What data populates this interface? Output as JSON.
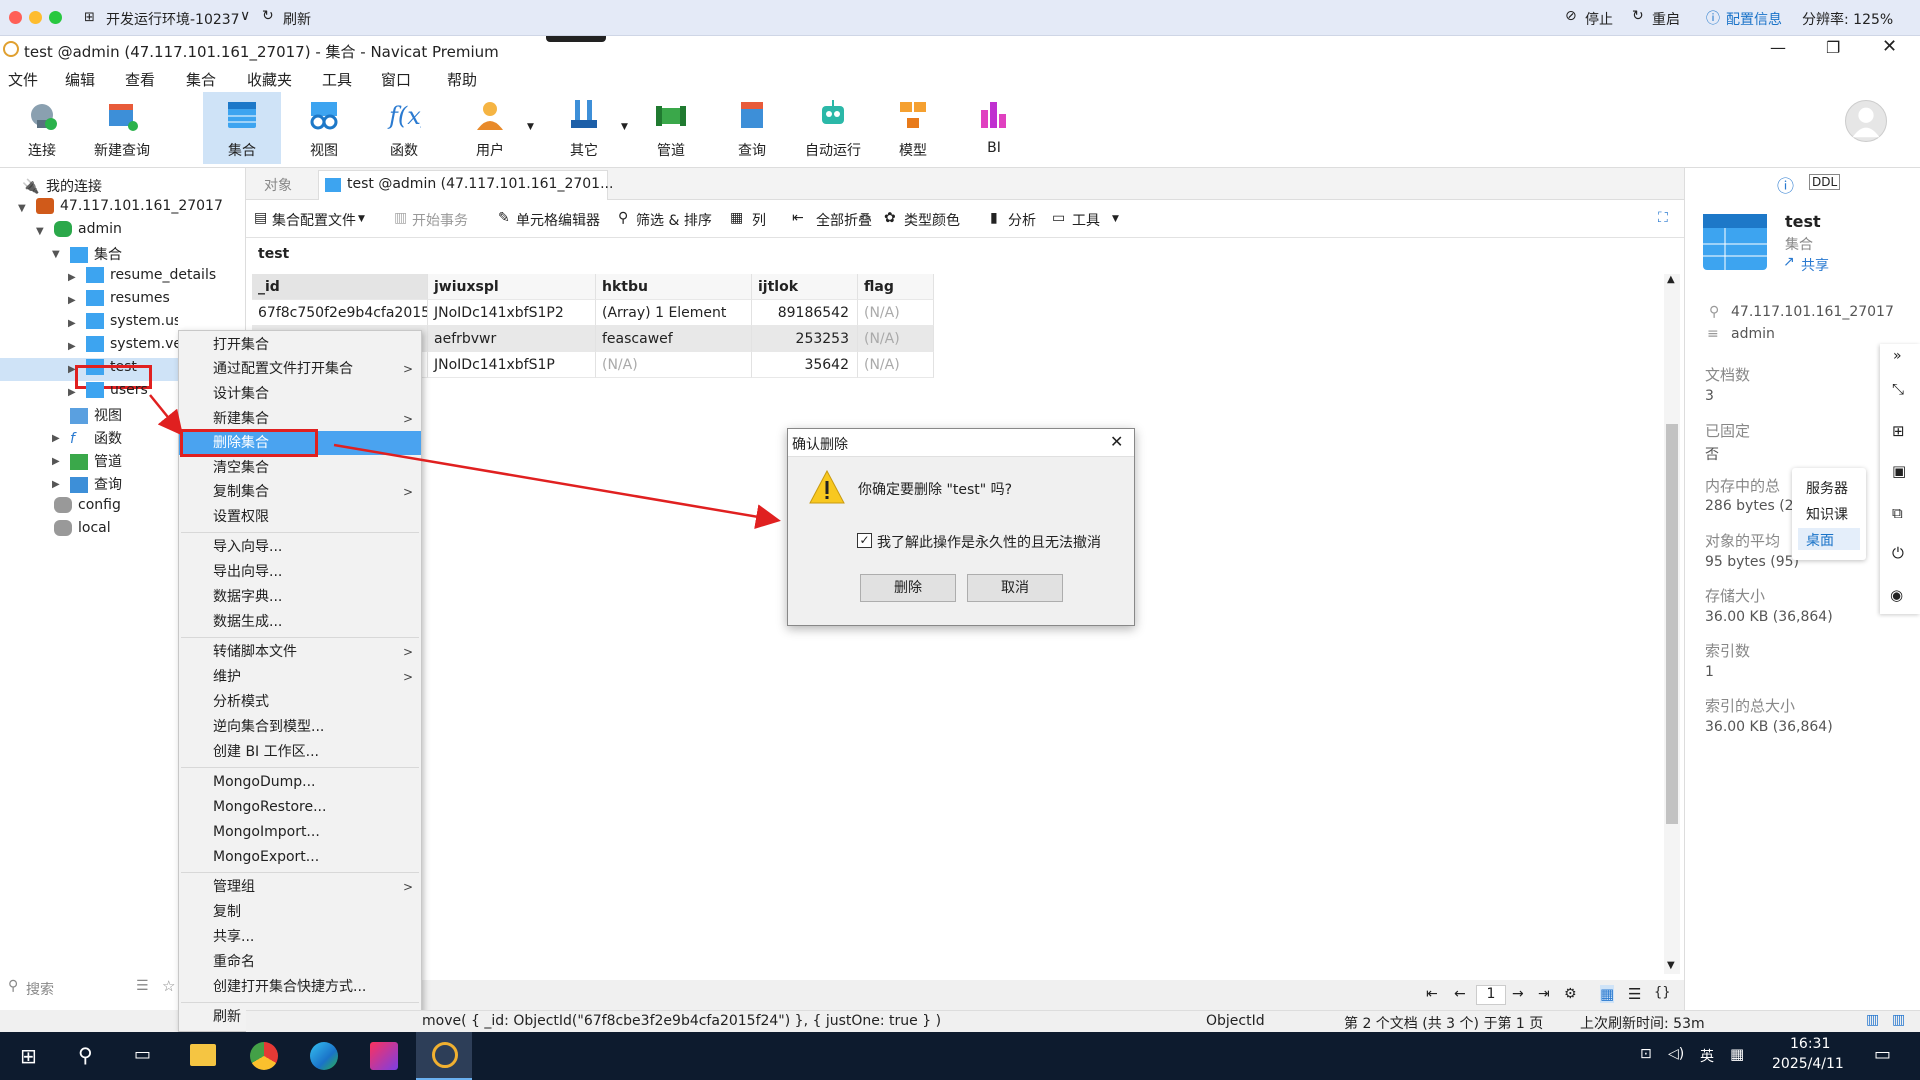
{
  "remote": {
    "env_label": "开发运行环境-10237",
    "refresh": "刷新",
    "stop": "停止",
    "restart": "重启",
    "config": "配置信息",
    "resolution": "分辨率: 125%"
  },
  "window": {
    "title": "test @admin (47.117.101.161_27017) - 集合 - Navicat Premium"
  },
  "menu": [
    "文件",
    "编辑",
    "查看",
    "集合",
    "收藏夹",
    "工具",
    "窗口",
    "帮助"
  ],
  "toolbar": [
    {
      "label": "连接",
      "icon": "plug-icon"
    },
    {
      "label": "新建查询",
      "icon": "new-query-icon"
    },
    {
      "label": "集合",
      "icon": "collection-icon"
    },
    {
      "label": "视图",
      "icon": "view-icon"
    },
    {
      "label": "函数",
      "icon": "function-icon"
    },
    {
      "label": "用户",
      "icon": "user-icon"
    },
    {
      "label": "其它",
      "icon": "tools-icon"
    },
    {
      "label": "管道",
      "icon": "pipeline-icon"
    },
    {
      "label": "查询",
      "icon": "query-icon"
    },
    {
      "label": "自动运行",
      "icon": "robot-icon"
    },
    {
      "label": "模型",
      "icon": "model-icon"
    },
    {
      "label": "BI",
      "icon": "bi-icon"
    }
  ],
  "sidebar": {
    "header": "我的连接",
    "connection": "47.117.101.161_27017",
    "db": "admin",
    "group": "集合",
    "collections": [
      "resume_details",
      "resumes",
      "system.users",
      "system.ve",
      "test",
      "users"
    ],
    "others": [
      "视图",
      "函数",
      "管道",
      "查询"
    ],
    "dbs": [
      "config",
      "local"
    ],
    "search_placeholder": "搜索"
  },
  "tabs": {
    "objects": "对象",
    "active": "test @admin (47.117.101.161_2701..."
  },
  "subtoolbar": [
    "集合配置文件",
    "开始事务",
    "单元格编辑器",
    "筛选 & 排序",
    "列",
    "全部折叠",
    "类型颜色",
    "分析",
    "工具"
  ],
  "grid": {
    "title": "test",
    "columns": [
      "_id",
      "jwiuxspl",
      "hktbu",
      "ijtlok",
      "flag"
    ],
    "rows": [
      [
        "67f8c750f2e9b4cfa2015",
        "JNoIDc141xbfS1P2",
        "(Array) 1 Element",
        "89186542",
        "(N/A)"
      ],
      [
        "",
        "aefrbvwr",
        "feascawef",
        "253253",
        "(N/A)"
      ],
      [
        "",
        "JNoIDc141xbfS1P",
        "(N/A)",
        "35642",
        "(N/A)"
      ]
    ]
  },
  "context_menu": {
    "items": [
      {
        "label": "打开集合",
        "sub": false
      },
      {
        "label": "通过配置文件打开集合",
        "sub": true
      },
      {
        "label": "设计集合",
        "sub": false
      },
      {
        "label": "新建集合",
        "sub": true
      },
      {
        "label": "删除集合",
        "sub": false
      },
      {
        "label": "清空集合",
        "sub": false
      },
      {
        "label": "复制集合",
        "sub": true
      },
      {
        "label": "设置权限",
        "sub": false
      },
      {
        "label": "导入向导...",
        "sub": false
      },
      {
        "label": "导出向导...",
        "sub": false
      },
      {
        "label": "数据字典...",
        "sub": false
      },
      {
        "label": "数据生成...",
        "sub": false
      },
      {
        "label": "转储脚本文件",
        "sub": true
      },
      {
        "label": "维护",
        "sub": true
      },
      {
        "label": "分析模式",
        "sub": false
      },
      {
        "label": "逆向集合到模型...",
        "sub": false
      },
      {
        "label": "创建 BI 工作区...",
        "sub": false
      },
      {
        "label": "MongoDump...",
        "sub": false
      },
      {
        "label": "MongoRestore...",
        "sub": false
      },
      {
        "label": "MongoImport...",
        "sub": false
      },
      {
        "label": "MongoExport...",
        "sub": false
      },
      {
        "label": "管理组",
        "sub": true
      },
      {
        "label": "复制",
        "sub": false
      },
      {
        "label": "共享...",
        "sub": false
      },
      {
        "label": "重命名",
        "sub": false
      },
      {
        "label": "创建打开集合快捷方式...",
        "sub": false
      },
      {
        "label": "刷新",
        "sub": false
      }
    ]
  },
  "dialog": {
    "title": "确认删除",
    "message": "你确定要删除 \"test\" 吗?",
    "checkbox": "我了解此操作是永久性的且无法撤消",
    "delete": "删除",
    "cancel": "取消"
  },
  "right_panel": {
    "name": "test",
    "type": "集合",
    "share": "共享",
    "host": "47.117.101.161_27017",
    "db": "admin",
    "doc_count_label": "文档数",
    "doc_count": "3",
    "capped_label": "已固定",
    "capped": "否",
    "mem_label": "内存中的总",
    "mem": "286 bytes (2",
    "avg_label": "对象的平均",
    "avg": "95 bytes (95)",
    "storage_label": "存储大小",
    "storage": "36.00 KB (36,864)",
    "index_label": "索引数",
    "index": "1",
    "index_size_label": "索引的总大小",
    "index_size": "36.00 KB (36,864)"
  },
  "popup": [
    "服务器",
    "知识课",
    "桌面"
  ],
  "pager": {
    "page": "1"
  },
  "status": {
    "query": "move( { _id: ObjectId(\"67f8cbe3f2e9b4cfa2015f24\") }, { justOne: true } )",
    "type": "ObjectId",
    "position": "第 2 个文档 (共 3 个) 于第 1 页",
    "refresh": "上次刷新时间: 53m"
  },
  "taskbar": {
    "time": "16:31",
    "date": "2025/4/11",
    "ime": "英"
  },
  "colors": {
    "accent": "#1a73c8",
    "delete_highlight": "#4aa3f0",
    "red_box": "#e02020"
  }
}
